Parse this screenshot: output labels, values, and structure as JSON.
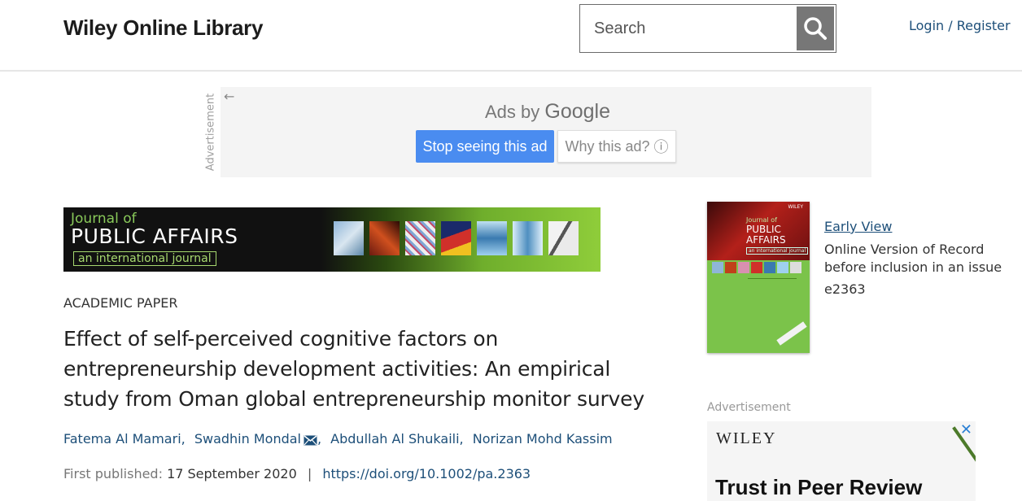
{
  "header": {
    "logo": "Wiley Online Library",
    "search_placeholder": "Search",
    "login": "Login / Register"
  },
  "ad": {
    "vertical_label": "Advertisement",
    "back_arrow": "←",
    "ads_by": "Ads by",
    "google": "Google",
    "stop_label": "Stop seeing this ad",
    "why_label": "Why this ad?",
    "info_glyph": "ⓘ"
  },
  "banner": {
    "line1": "Journal of",
    "line2": "PUBLIC AFFAIRS",
    "line3": "an international journal"
  },
  "article": {
    "type": "ACADEMIC PAPER",
    "title": "Effect of self-perceived cognitive factors on entrepreneurship development activities: An empirical study from Oman global entrepreneurship monitor survey",
    "authors": [
      "Fatema Al Mamari",
      "Swadhin Mondal",
      "Abdullah Al Shukaili",
      "Norizan Mohd Kassim"
    ],
    "first_published_label": "First published:",
    "first_published_date": "17 September 2020",
    "doi": "https://doi.org/10.1002/pa.2363"
  },
  "sidebar": {
    "cover": {
      "publisher": "WILEY",
      "journal_line1": "Journal of",
      "journal_line2": "PUBLIC AFFAIRS",
      "journal_line3": "an international journal"
    },
    "early_view": "Early View",
    "version_note": "Online Version of Record before inclusion in an issue",
    "article_number": "e2363",
    "ad_label": "Advertisement",
    "ad_close": "✕",
    "ad_brand": "WILEY",
    "ad_headline": "Trust in Peer Review"
  },
  "colors": {
    "link": "#1d4f79",
    "ad_button": "#4a8cf0",
    "search_button": "#777777",
    "journal_green": "#7bc34a"
  },
  "icons": {
    "search": "magnifier-icon",
    "mail": "envelope-icon",
    "close": "close-icon",
    "back": "arrow-left-icon",
    "info": "info-icon"
  }
}
